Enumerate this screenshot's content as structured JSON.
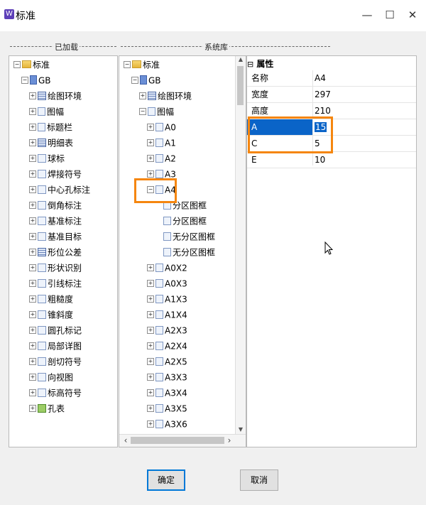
{
  "window": {
    "title": "标准",
    "app_icon": "app-logo-icon",
    "min_glyph": "—",
    "max_glyph": "☐",
    "close_glyph": "✕"
  },
  "sections": {
    "loaded": "已加载",
    "library": "系统库"
  },
  "loaded_tree": [
    {
      "label": "标准",
      "icon": "folder",
      "exp": "−",
      "indent": 0
    },
    {
      "label": "GB",
      "icon": "book",
      "exp": "−",
      "indent": 1
    },
    {
      "label": "绘图环境",
      "icon": "tbl",
      "exp": "+",
      "indent": 2
    },
    {
      "label": "图幅",
      "icon": "doc",
      "exp": "+",
      "indent": 2
    },
    {
      "label": "标题栏",
      "icon": "doc",
      "exp": "+",
      "indent": 2
    },
    {
      "label": "明细表",
      "icon": "tbl",
      "exp": "+",
      "indent": 2
    },
    {
      "label": "球标",
      "icon": "sym",
      "exp": "+",
      "indent": 2
    },
    {
      "label": "焊接符号",
      "icon": "sym",
      "exp": "+",
      "indent": 2
    },
    {
      "label": "中心孔标注",
      "icon": "sym",
      "exp": "+",
      "indent": 2
    },
    {
      "label": "倒角标注",
      "icon": "sym",
      "exp": "+",
      "indent": 2
    },
    {
      "label": "基准标注",
      "icon": "sym",
      "exp": "+",
      "indent": 2
    },
    {
      "label": "基准目标",
      "icon": "sym",
      "exp": "+",
      "indent": 2
    },
    {
      "label": "形位公差",
      "icon": "tbl",
      "exp": "+",
      "indent": 2
    },
    {
      "label": "形状识别",
      "icon": "sym",
      "exp": "+",
      "indent": 2
    },
    {
      "label": "引线标注",
      "icon": "sym",
      "exp": "+",
      "indent": 2
    },
    {
      "label": "粗糙度",
      "icon": "sym",
      "exp": "+",
      "indent": 2
    },
    {
      "label": "锥斜度",
      "icon": "sym",
      "exp": "+",
      "indent": 2
    },
    {
      "label": "圆孔标记",
      "icon": "sym",
      "exp": "+",
      "indent": 2
    },
    {
      "label": "局部详图",
      "icon": "sym",
      "exp": "+",
      "indent": 2
    },
    {
      "label": "剖切符号",
      "icon": "sym",
      "exp": "+",
      "indent": 2
    },
    {
      "label": "向视图",
      "icon": "sym",
      "exp": "+",
      "indent": 2
    },
    {
      "label": "标高符号",
      "icon": "sym",
      "exp": "+",
      "indent": 2
    },
    {
      "label": "孔表",
      "icon": "grn",
      "exp": "+",
      "indent": 2
    }
  ],
  "library_tree": [
    {
      "label": "标准",
      "icon": "folder",
      "exp": "−",
      "indent": 0
    },
    {
      "label": "GB",
      "icon": "book",
      "exp": "−",
      "indent": 1
    },
    {
      "label": "绘图环境",
      "icon": "tbl",
      "exp": "+",
      "indent": 2
    },
    {
      "label": "图幅",
      "icon": "doc",
      "exp": "−",
      "indent": 2
    },
    {
      "label": "A0",
      "icon": "doc",
      "exp": "+",
      "indent": 3
    },
    {
      "label": "A1",
      "icon": "doc",
      "exp": "+",
      "indent": 3
    },
    {
      "label": "A2",
      "icon": "doc",
      "exp": "+",
      "indent": 3
    },
    {
      "label": "A3",
      "icon": "doc",
      "exp": "+",
      "indent": 3
    },
    {
      "label": "A4",
      "icon": "doc",
      "exp": "−",
      "indent": 3
    },
    {
      "label": "分区图框",
      "icon": "doc",
      "exp": "",
      "indent": 4
    },
    {
      "label": "分区图框",
      "icon": "doc",
      "exp": "",
      "indent": 4
    },
    {
      "label": "无分区图框",
      "icon": "doc",
      "exp": "",
      "indent": 4
    },
    {
      "label": "无分区图框",
      "icon": "doc",
      "exp": "",
      "indent": 4
    },
    {
      "label": "A0X2",
      "icon": "doc",
      "exp": "+",
      "indent": 3
    },
    {
      "label": "A0X3",
      "icon": "doc",
      "exp": "+",
      "indent": 3
    },
    {
      "label": "A1X3",
      "icon": "doc",
      "exp": "+",
      "indent": 3
    },
    {
      "label": "A1X4",
      "icon": "doc",
      "exp": "+",
      "indent": 3
    },
    {
      "label": "A2X3",
      "icon": "doc",
      "exp": "+",
      "indent": 3
    },
    {
      "label": "A2X4",
      "icon": "doc",
      "exp": "+",
      "indent": 3
    },
    {
      "label": "A2X5",
      "icon": "doc",
      "exp": "+",
      "indent": 3
    },
    {
      "label": "A3X3",
      "icon": "doc",
      "exp": "+",
      "indent": 3
    },
    {
      "label": "A3X4",
      "icon": "doc",
      "exp": "+",
      "indent": 3
    },
    {
      "label": "A3X5",
      "icon": "doc",
      "exp": "+",
      "indent": 3
    },
    {
      "label": "A3X6",
      "icon": "doc",
      "exp": "+",
      "indent": 3
    }
  ],
  "properties": {
    "header": "属性",
    "header_glyph": "⊟",
    "rows": [
      {
        "name": "名称",
        "value": "A4",
        "selected": false
      },
      {
        "name": "宽度",
        "value": "297",
        "selected": false
      },
      {
        "name": "高度",
        "value": "210",
        "selected": false
      },
      {
        "name": "A",
        "value": "15",
        "selected": true
      },
      {
        "name": "C",
        "value": "5",
        "selected": false
      },
      {
        "name": "E",
        "value": "10",
        "selected": false
      }
    ]
  },
  "scroll": {
    "left_arrow": "‹",
    "right_arrow": "›",
    "up_arrow": "▲",
    "down_arrow": "▼"
  },
  "buttons": {
    "ok": "确定",
    "cancel": "取消"
  },
  "colors": {
    "highlight": "#f5860f",
    "selection": "#0a64c8"
  }
}
